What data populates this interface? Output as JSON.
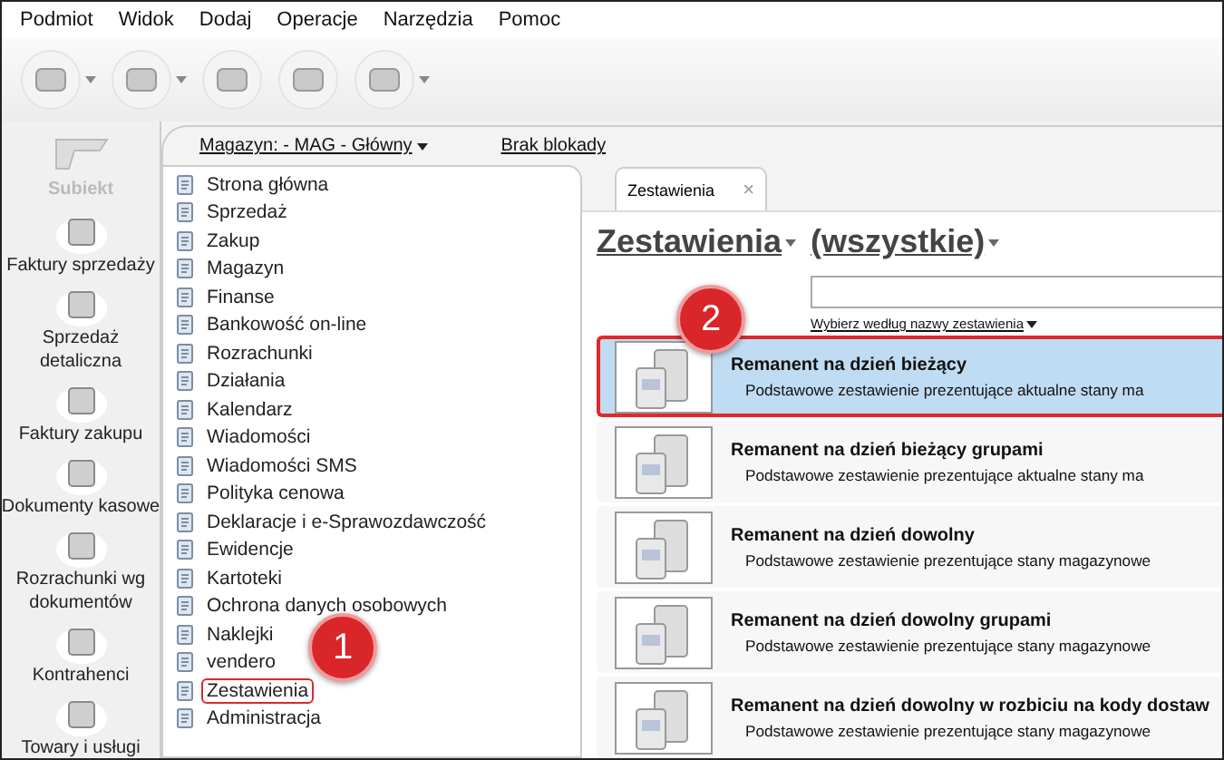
{
  "menu": [
    "Podmiot",
    "Widok",
    "Dodaj",
    "Operacje",
    "Narzędzia",
    "Pomoc"
  ],
  "toolbar": [
    {
      "dropdown": true
    },
    {
      "dropdown": true
    },
    {
      "dropdown": false
    },
    {
      "dropdown": false
    },
    {
      "dropdown": true
    }
  ],
  "sidebar": {
    "logo": "Subiekt",
    "items": [
      "Faktury sprzedaży",
      "Sprzedaż detaliczna",
      "Faktury zakupu",
      "Dokumenty kasowe",
      "Rozrachunki wg dokumentów",
      "Kontrahenci",
      "Towary i usługi"
    ]
  },
  "header_links": [
    {
      "label": "Magazyn: - MAG - Główny",
      "dropdown": true
    },
    {
      "label": "Brak blokady",
      "dropdown": false
    }
  ],
  "nav_items": [
    {
      "label": "Strona główna",
      "highlighted": false
    },
    {
      "label": "Sprzedaż",
      "highlighted": false
    },
    {
      "label": "Zakup",
      "highlighted": false
    },
    {
      "label": "Magazyn",
      "highlighted": false
    },
    {
      "label": "Finanse",
      "highlighted": false
    },
    {
      "label": "Bankowość on-line",
      "highlighted": false
    },
    {
      "label": "Rozrachunki",
      "highlighted": false
    },
    {
      "label": "Działania",
      "highlighted": false
    },
    {
      "label": "Kalendarz",
      "highlighted": false
    },
    {
      "label": "Wiadomości",
      "highlighted": false
    },
    {
      "label": "Wiadomości SMS",
      "highlighted": false
    },
    {
      "label": "Polityka cenowa",
      "highlighted": false
    },
    {
      "label": "Deklaracje i e-Sprawozdawczość",
      "highlighted": false
    },
    {
      "label": "Ewidencje",
      "highlighted": false
    },
    {
      "label": "Kartoteki",
      "highlighted": false
    },
    {
      "label": "Ochrona danych osobowych",
      "highlighted": false
    },
    {
      "label": "Naklejki",
      "highlighted": false
    },
    {
      "label": "vendero",
      "highlighted": false
    },
    {
      "label": "Zestawienia",
      "highlighted": true
    },
    {
      "label": "Administracja",
      "highlighted": false
    }
  ],
  "tab": {
    "label": "Zestawienia",
    "close": "×"
  },
  "heading": {
    "category": "Zestawienia",
    "filter": "(wszystkie)"
  },
  "sort_link": "Wybierz według nazwy zestawienia",
  "reports": [
    {
      "title": "Remanent na dzień bieżący",
      "description": "Podstawowe zestawienie prezentujące aktualne stany ma",
      "selected": true,
      "highlighted": true
    },
    {
      "title": "Remanent na dzień bieżący grupami",
      "description": "Podstawowe zestawienie prezentujące aktualne stany ma",
      "selected": false,
      "highlighted": false
    },
    {
      "title": "Remanent na dzień dowolny",
      "description": "Podstawowe zestawienie prezentujące stany magazynowe",
      "selected": false,
      "highlighted": false
    },
    {
      "title": "Remanent na dzień dowolny grupami",
      "description": "Podstawowe zestawienie prezentujące stany magazynowe",
      "selected": false,
      "highlighted": false
    },
    {
      "title": "Remanent na dzień dowolny w rozbiciu na kody dostaw",
      "description": "Podstawowe zestawienie prezentujące stany magazynowe",
      "selected": false,
      "highlighted": false
    }
  ],
  "callouts": [
    "1",
    "2"
  ]
}
